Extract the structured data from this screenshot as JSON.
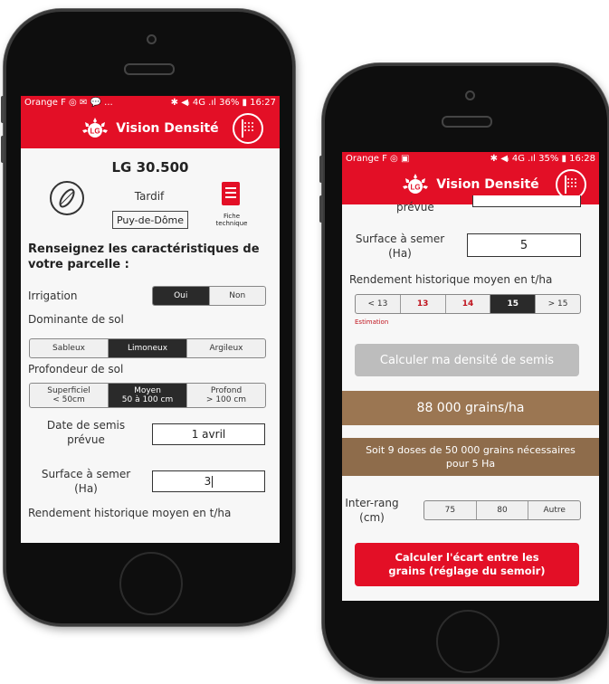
{
  "app": {
    "title": "Vision Densité",
    "logo_text": "LG",
    "accent": "#e30f26"
  },
  "left": {
    "status": {
      "carrier": "Orange F ◎ ✉ 💬 ...",
      "right": "✱ ◀ᵢ 4G .ıl 36% ▮ 16:27"
    },
    "variety": {
      "name": "LG 30.500",
      "maturity": "Tardif",
      "region": "Puy-de-Dôme",
      "fiche_label": "Fiche technique"
    },
    "section_title": "Renseignez les caractéristiques de votre parcelle :",
    "irrigation": {
      "label": "Irrigation",
      "options": [
        "Oui",
        "Non"
      ],
      "selected": "Oui"
    },
    "sol": {
      "label": "Dominante de sol",
      "options": [
        "Sableux",
        "Limoneux",
        "Argileux"
      ],
      "selected": "Limoneux"
    },
    "profondeur": {
      "label": "Profondeur de sol",
      "options": [
        {
          "top": "Superficiel",
          "bottom": "< 50cm"
        },
        {
          "top": "Moyen",
          "bottom": "50 à 100 cm"
        },
        {
          "top": "Profond",
          "bottom": "> 100 cm"
        }
      ],
      "selected": "Moyen"
    },
    "date": {
      "label": "Date de semis prévue",
      "value": "1 avril"
    },
    "surface": {
      "label": "Surface à semer (Ha)",
      "value": "3"
    },
    "rendement_label": "Rendement historique moyen en t/ha"
  },
  "right": {
    "status": {
      "carrier": "Orange F ◎ ▣",
      "right": "✱ ◀ᵢ 4G .ıl 35% ▮ 16:28"
    },
    "prevue_fragment": "prévue",
    "surface": {
      "label": "Surface à semer (Ha)",
      "value": "5"
    },
    "rendement": {
      "label": "Rendement historique moyen en t/ha",
      "options": [
        "< 13",
        "13",
        "14",
        "15",
        "> 15"
      ],
      "selected": "15",
      "estimation": "Estimation"
    },
    "calc_button": "Calculer ma densité de semis",
    "result": "88 000 grains/ha",
    "doses": "Soit 9 doses de 50 000 grains nécessaires pour 5 Ha",
    "interrang": {
      "label": "Inter-rang (cm)",
      "options": [
        "75",
        "80",
        "Autre"
      ]
    },
    "ecart_button": "Calculer l'écart entre les grains (réglage du semoir)",
    "colors": {
      "result_bg": "#9b7652",
      "doses_bg": "#8e6c4b",
      "disabled_btn": "#bdbdbd",
      "red_text": "#c0141e"
    }
  }
}
